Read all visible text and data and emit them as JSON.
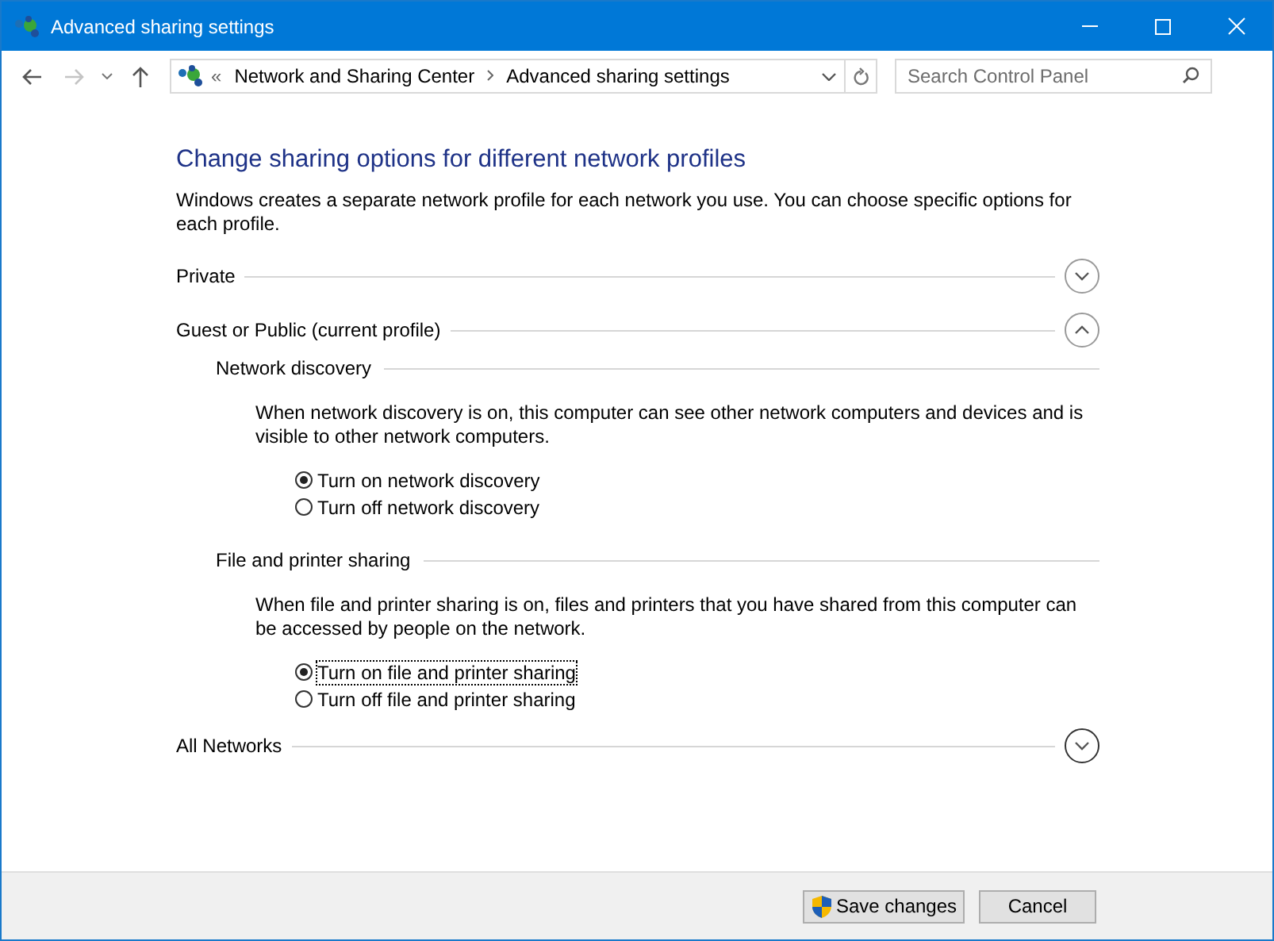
{
  "window": {
    "title": "Advanced sharing settings"
  },
  "breadcrumbs": [
    {
      "label": "Network and Sharing Center"
    },
    {
      "label": "Advanced sharing settings"
    }
  ],
  "overflow_mark": "«",
  "search": {
    "placeholder": "Search Control Panel"
  },
  "heading": "Change sharing options for different network profiles",
  "intro": "Windows creates a separate network profile for each network you use. You can choose specific options for each profile.",
  "profiles": [
    {
      "name": "Private",
      "expanded": false
    },
    {
      "name": "Guest or Public (current profile)",
      "expanded": true,
      "sections": [
        {
          "title": "Network discovery",
          "description": "When network discovery is on, this computer can see other network computers and devices and is visible to other network computers.",
          "options": [
            {
              "label": "Turn on network discovery",
              "selected": true,
              "focused": false
            },
            {
              "label": "Turn off network discovery",
              "selected": false,
              "focused": false
            }
          ]
        },
        {
          "title": "File and printer sharing",
          "description": "When file and printer sharing is on, files and printers that you have shared from this computer can be accessed by people on the network.",
          "options": [
            {
              "label": "Turn on file and printer sharing",
              "selected": true,
              "focused": true
            },
            {
              "label": "Turn off file and printer sharing",
              "selected": false,
              "focused": false
            }
          ]
        }
      ]
    },
    {
      "name": "All Networks",
      "expanded": false
    }
  ],
  "buttons": [
    {
      "label": "Save changes",
      "kind": "shield"
    },
    {
      "label": "Cancel",
      "kind": "plain"
    }
  ]
}
